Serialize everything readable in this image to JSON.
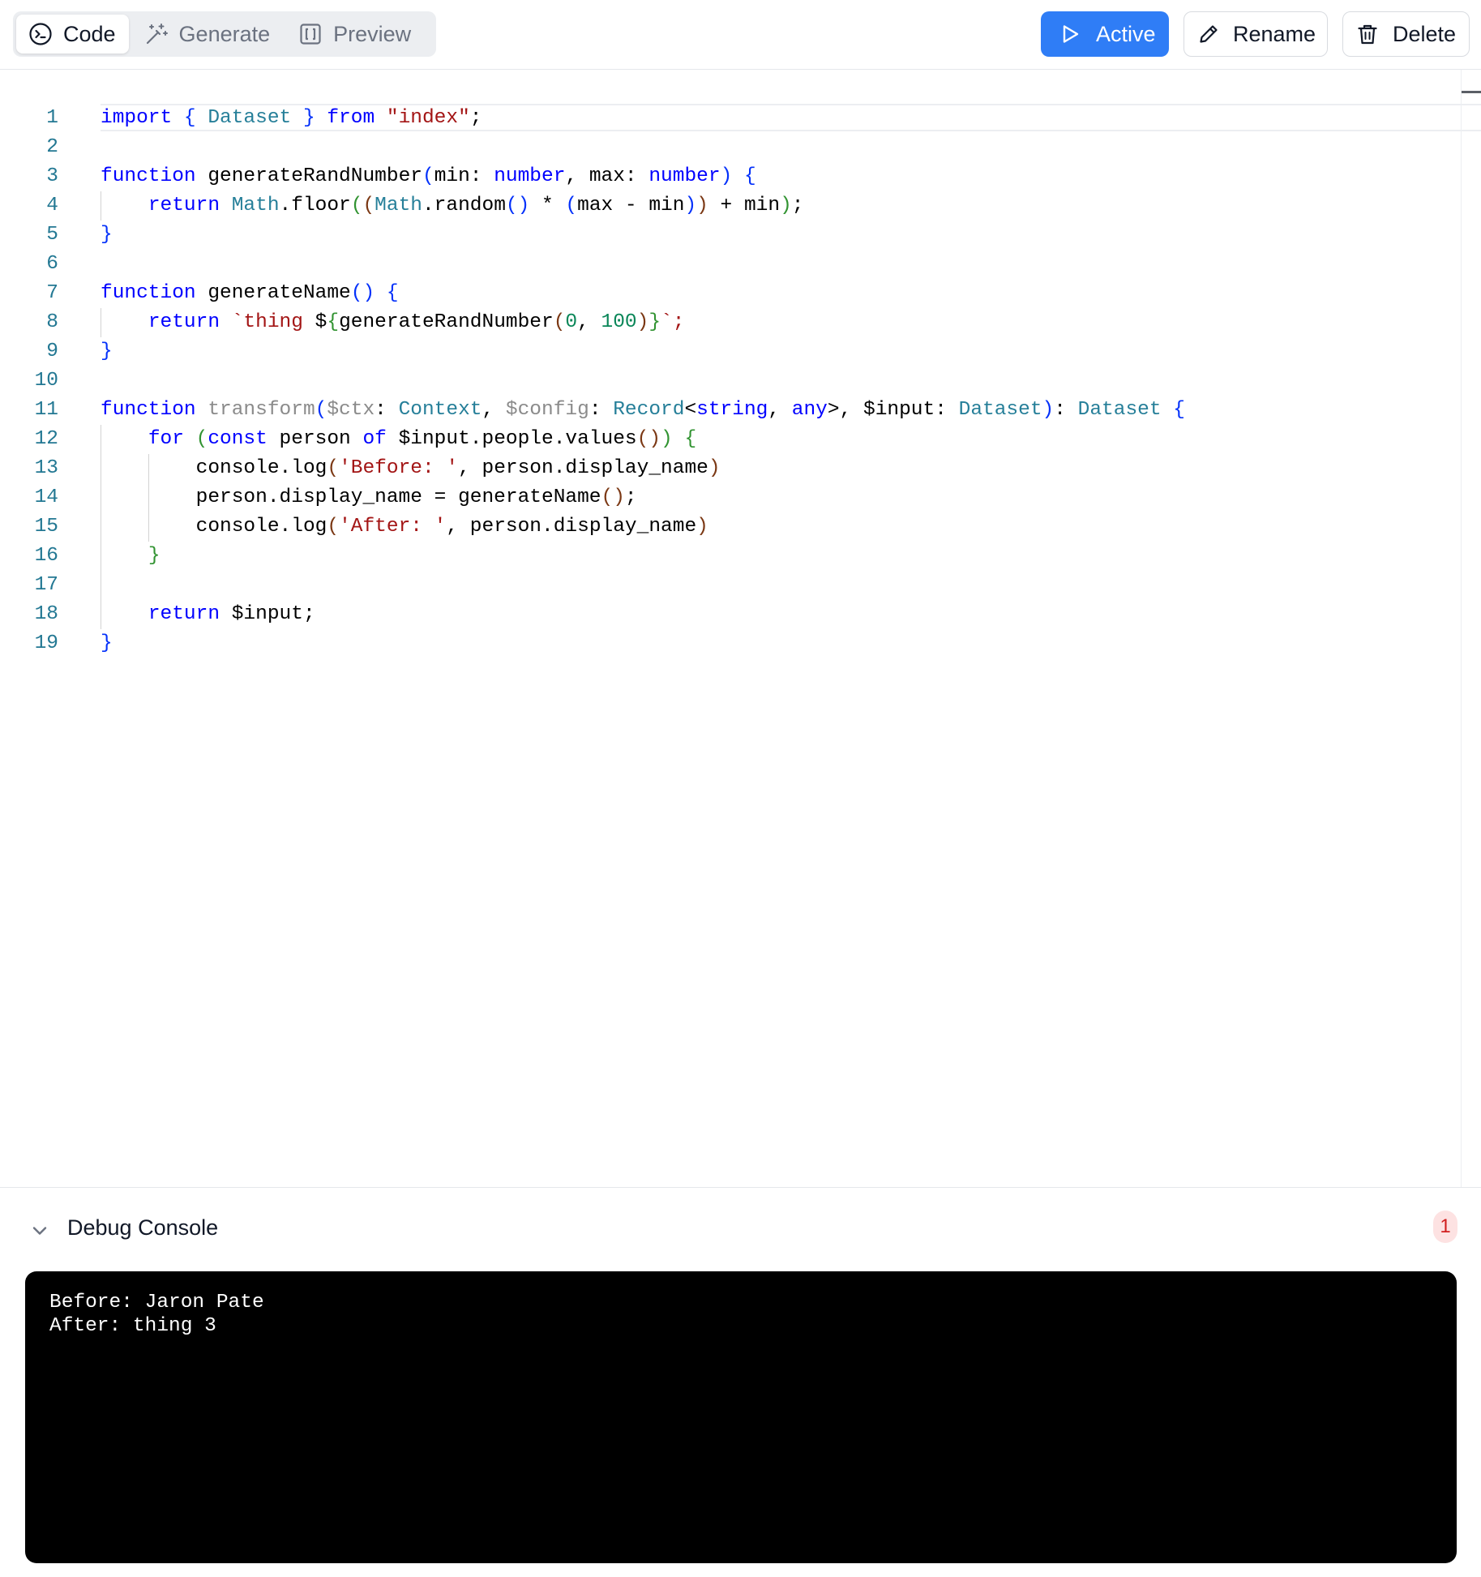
{
  "toolbar": {
    "tabs": [
      {
        "label": "Code",
        "icon": "terminal-icon",
        "active": true
      },
      {
        "label": "Generate",
        "icon": "magic-wand-icon",
        "active": false
      },
      {
        "label": "Preview",
        "icon": "brackets-icon",
        "active": false
      }
    ],
    "active_label": "Active",
    "rename_label": "Rename",
    "delete_label": "Delete",
    "accent_color": "#2f7df6"
  },
  "editor": {
    "line_numbers": [
      "1",
      "2",
      "3",
      "4",
      "5",
      "6",
      "7",
      "8",
      "9",
      "10",
      "11",
      "12",
      "13",
      "14",
      "15",
      "16",
      "17",
      "18",
      "19"
    ],
    "code_lines": [
      "import { Dataset } from \"index\";",
      "",
      "function generateRandNumber(min: number, max: number) {",
      "    return Math.floor((Math.random() * (max - min)) + min);",
      "}",
      "",
      "function generateName() {",
      "    return `thing ${generateRandNumber(0, 100)}`;",
      "}",
      "",
      "function transform($ctx: Context, $config: Record<string, any>, $input: Dataset): Dataset {",
      "    for (const person of $input.people.values()) {",
      "        console.log('Before: ', person.display_name)",
      "        person.display_name = generateName();",
      "        console.log('After: ', person.display_name)",
      "    }",
      "",
      "    return $input;",
      "}"
    ]
  },
  "debug_console": {
    "title": "Debug Console",
    "count": "1",
    "output": [
      "Before: Jaron Pate",
      "After: thing 3"
    ]
  }
}
